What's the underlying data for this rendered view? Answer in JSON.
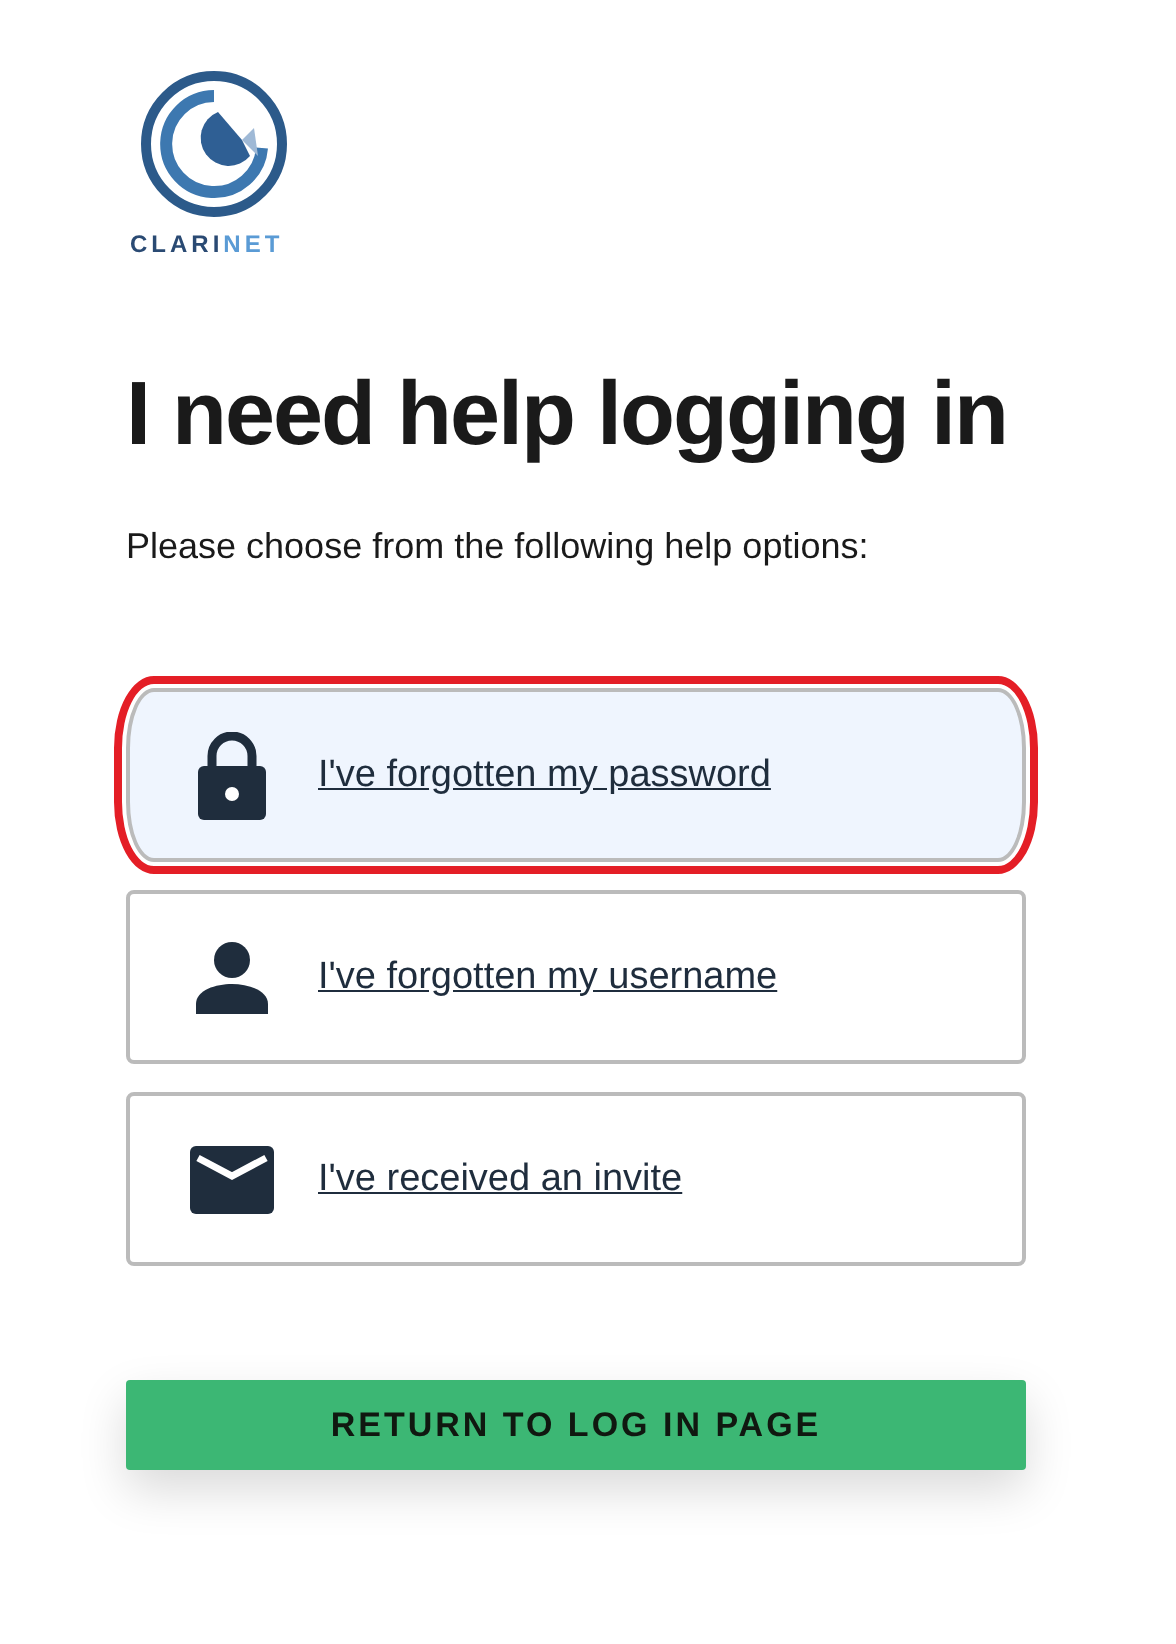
{
  "logo": {
    "name_main": "CLARI",
    "name_accent": "NET"
  },
  "heading": "I need help logging in",
  "intro": "Please choose from the following help options:",
  "options": [
    {
      "kind": "password",
      "label": "I've forgotten my password",
      "highlighted": true
    },
    {
      "kind": "username",
      "label": "I've forgotten my username",
      "highlighted": false
    },
    {
      "kind": "invite",
      "label": "I've received an invite",
      "highlighted": false
    }
  ],
  "return_button": "RETURN TO LOG IN PAGE"
}
